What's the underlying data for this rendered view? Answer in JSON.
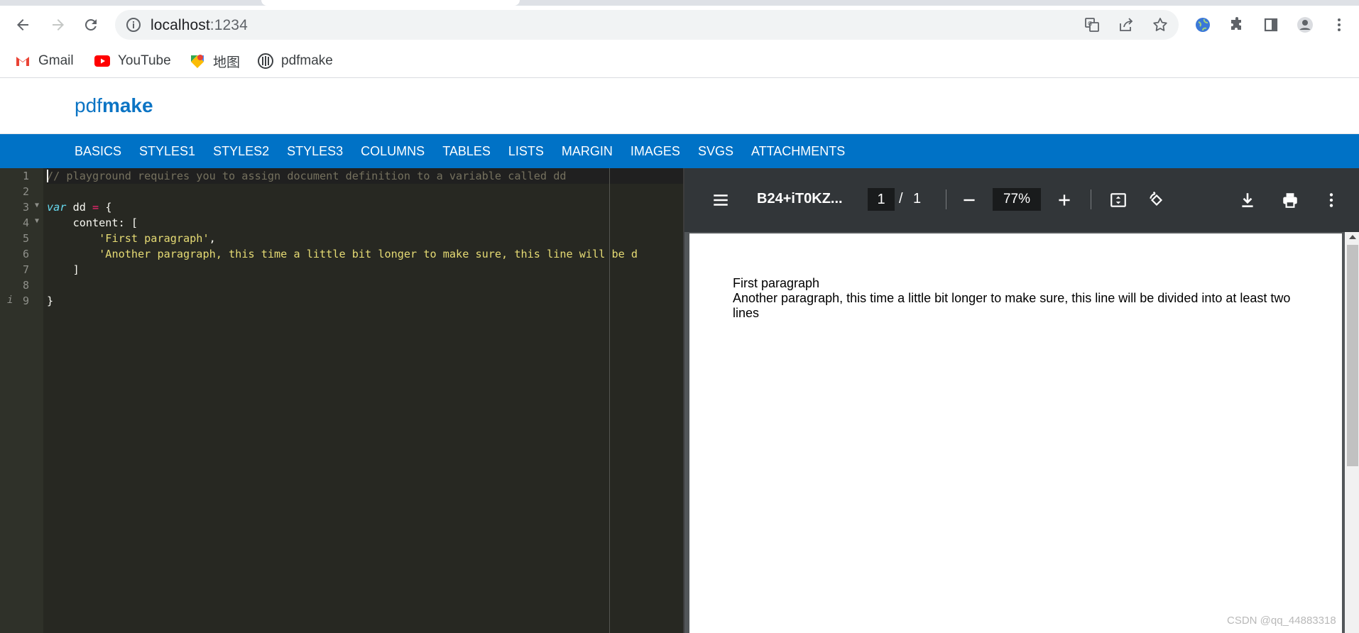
{
  "browser": {
    "url_host": "localhost",
    "url_port": ":1234",
    "bookmarks": [
      {
        "label": "Gmail",
        "icon": "gmail-icon"
      },
      {
        "label": "YouTube",
        "icon": "youtube-icon"
      },
      {
        "label": "地图",
        "icon": "maps-icon"
      },
      {
        "label": "pdfmake",
        "icon": "pdfmake-icon"
      }
    ]
  },
  "site": {
    "brand_light": "pdf",
    "brand_bold": "make",
    "nav": [
      "BASICS",
      "STYLES1",
      "STYLES2",
      "STYLES3",
      "COLUMNS",
      "TABLES",
      "LISTS",
      "MARGIN",
      "IMAGES",
      "SVGS",
      "ATTACHMENTS"
    ]
  },
  "editor": {
    "line_numbers": [
      "1",
      "2",
      "3",
      "4",
      "5",
      "6",
      "7",
      "8",
      "9"
    ],
    "comment": "// playground requires you to assign document definition to a variable called dd",
    "kw_var": "var",
    "var_name": " dd ",
    "eq": "=",
    "open_brace": " {",
    "content_key": "    content: [",
    "indent": "        ",
    "str1": "'First paragraph'",
    "comma": ",",
    "str2": "'Another paragraph, this time a little bit longer to make sure, this line will be d",
    "close_bracket": "    ]",
    "close_brace": "}"
  },
  "viewer": {
    "doc_title": "B24+iT0KZ...",
    "page_current": "1",
    "page_sep": "/",
    "page_total": "1",
    "zoom": "77%",
    "paragraph1": "First paragraph",
    "paragraph2": "Another paragraph, this time a little bit longer to make sure, this line will be divided into at least two lines"
  },
  "watermark": "CSDN @qq_44883318",
  "colors": {
    "nav_blue": "#0072c6",
    "brand_blue": "#0b74c4",
    "editor_bg": "#272822",
    "viewer_toolbar": "#323639"
  }
}
